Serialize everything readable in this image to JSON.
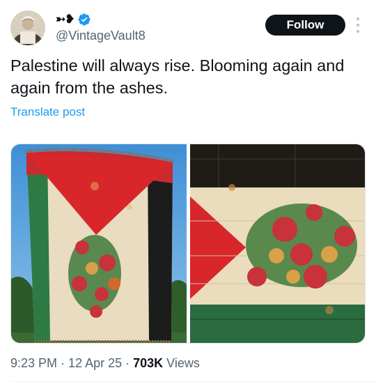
{
  "header": {
    "display_name_symbols": "➳❥",
    "verified": true,
    "handle": "@VintageVault8",
    "follow_label": "Follow"
  },
  "post": {
    "text": "Palestine will always rise. Blooming again and again from the ashes.",
    "translate_label": "Translate post"
  },
  "media": {
    "images": [
      {
        "name": "palestine-flag-blanket-with-roses"
      },
      {
        "name": "palestine-flag-roses-closeup"
      }
    ]
  },
  "meta": {
    "time": "9:23 PM",
    "date": "12 Apr 25",
    "views_count": "703K",
    "views_label": "Views"
  },
  "colors": {
    "accent": "#1d9bf0",
    "text": "#0f1419",
    "secondary": "#536471",
    "flag_red": "#d8262b",
    "flag_green": "#2d7a45",
    "flag_black": "#1a1a1a"
  }
}
